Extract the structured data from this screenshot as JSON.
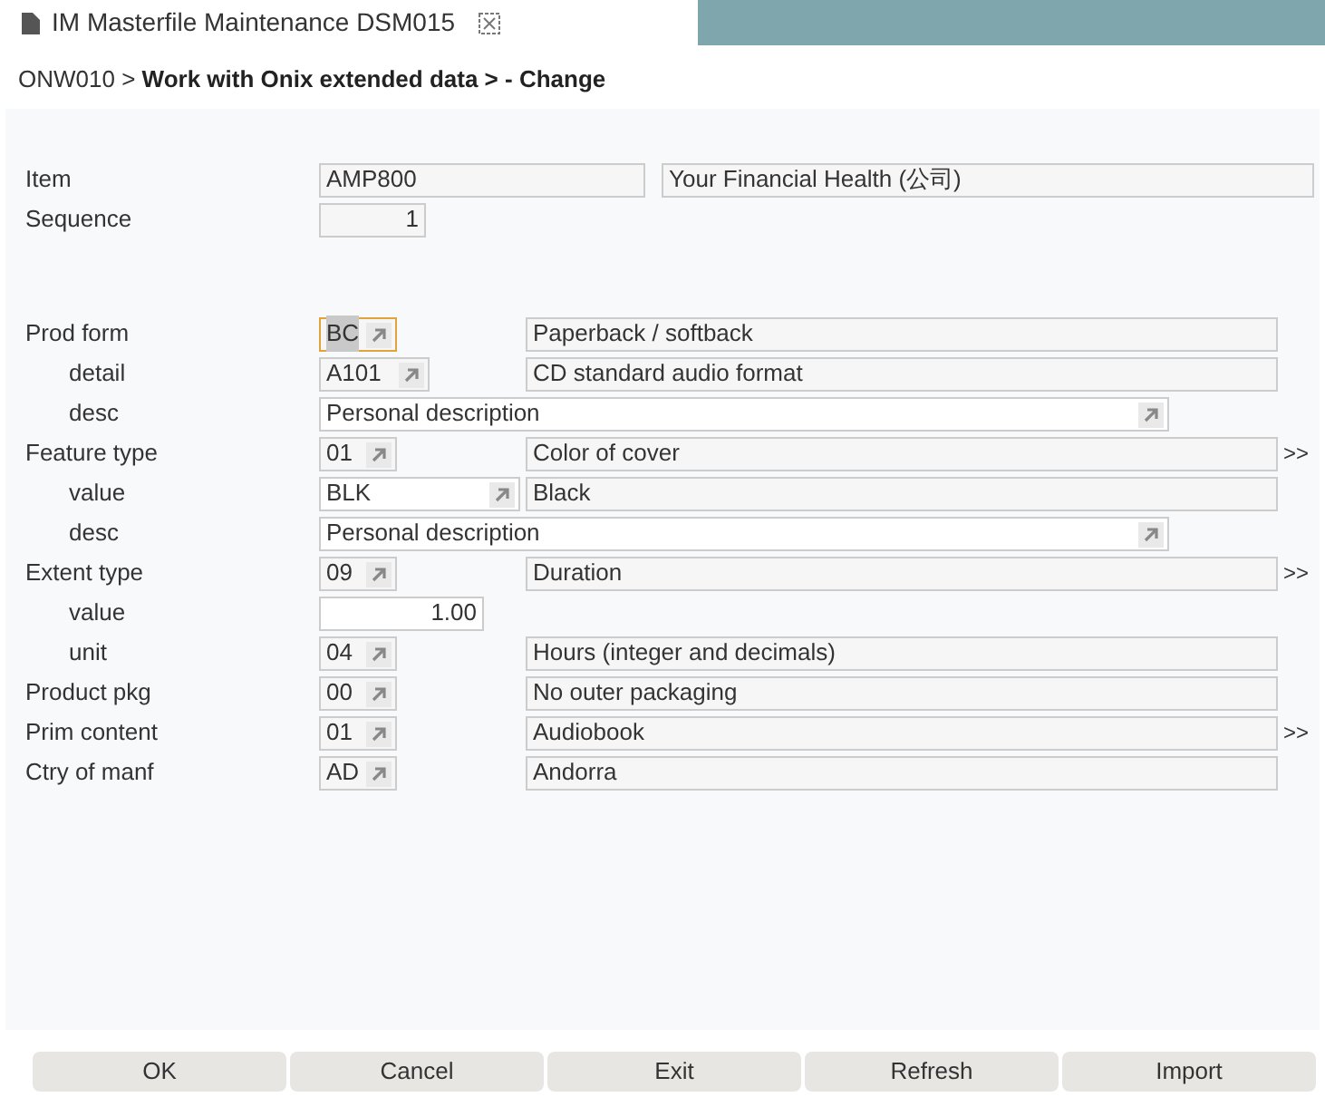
{
  "tab": {
    "title": "IM Masterfile Maintenance DSM015",
    "selected": true
  },
  "breadcrumb": {
    "parent": "ONW010 >",
    "current": "Work with Onix extended data > - Change"
  },
  "key_rows": [
    {
      "label": "Item",
      "fields": [
        {
          "kind": "text",
          "value": "AMP800",
          "focused": false
        },
        {
          "kind": "title",
          "value": "Your Financial Health (公司)",
          "focused": false
        }
      ]
    },
    {
      "label": "Sequence",
      "fields": [
        {
          "kind": "number",
          "value": "1",
          "focused": false
        }
      ]
    }
  ],
  "detail_rows": [
    {
      "label": "Prod form",
      "more": false,
      "fields": [
        {
          "kind": "code",
          "value": "BC",
          "focused": true
        },
        {
          "kind": "desc",
          "value": "Paperback / softback",
          "focused": false
        }
      ],
      "children": [
        {
          "label": "detail",
          "more": false,
          "fields": [
            {
              "kind": "wide",
              "value": "A101",
              "focused": false
            },
            {
              "kind": "desc",
              "value": "CD standard audio format",
              "focused": false
            }
          ]
        },
        {
          "label": "desc",
          "more": false,
          "fields": [
            {
              "kind": "long",
              "value": "Personal description",
              "focused": false
            }
          ]
        }
      ]
    },
    {
      "label": "Feature type",
      "more": true,
      "more_text": ">>",
      "fields": [
        {
          "kind": "code",
          "value": "01",
          "focused": false
        },
        {
          "kind": "desc",
          "value": "Color of cover",
          "focused": false
        }
      ],
      "children": [
        {
          "label": "value",
          "more": false,
          "fields": [
            {
              "kind": "wider",
              "value": "BLK",
              "focused": false
            },
            {
              "kind": "desc",
              "value": "Black",
              "focused": false
            }
          ]
        },
        {
          "label": "desc",
          "more": false,
          "fields": [
            {
              "kind": "long",
              "value": "Personal description",
              "focused": false
            }
          ]
        }
      ]
    },
    {
      "label": "Extent type",
      "more": true,
      "more_text": ">>",
      "fields": [
        {
          "kind": "code",
          "value": "09",
          "focused": false
        },
        {
          "kind": "desc",
          "value": "Duration",
          "focused": false
        }
      ],
      "children": [
        {
          "label": "value",
          "more": false,
          "fields": [
            {
              "kind": "amount",
              "value": "1.00",
              "focused": false
            }
          ]
        },
        {
          "label": "unit",
          "more": false,
          "fields": [
            {
              "kind": "code",
              "value": "04",
              "focused": false
            },
            {
              "kind": "desc",
              "value": "Hours (integer and decimals)",
              "focused": false
            }
          ]
        }
      ]
    },
    {
      "label": "Product pkg",
      "more": false,
      "fields": [
        {
          "kind": "code",
          "value": "00",
          "focused": false
        },
        {
          "kind": "desc",
          "value": "No outer packaging",
          "focused": false
        }
      ]
    },
    {
      "label": "Prim content",
      "more": true,
      "more_text": ">>",
      "fields": [
        {
          "kind": "code",
          "value": "01",
          "focused": false
        },
        {
          "kind": "desc",
          "value": "Audiobook",
          "focused": false
        }
      ]
    },
    {
      "label": "Ctry of manf",
      "more": false,
      "fields": [
        {
          "kind": "code",
          "value": "AD",
          "focused": false
        },
        {
          "kind": "desc",
          "value": "Andorra",
          "focused": false
        }
      ]
    }
  ],
  "buttons": [
    "OK",
    "Cancel",
    "Exit",
    "Refresh",
    "Import"
  ]
}
